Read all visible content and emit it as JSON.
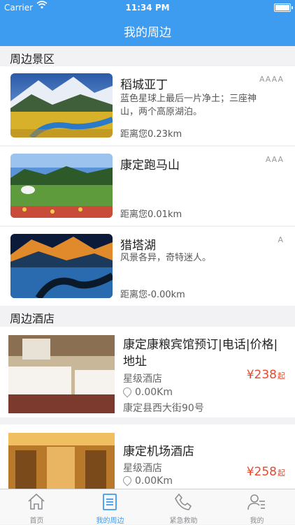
{
  "status": {
    "carrier": "Carrier",
    "time": "11:34 PM"
  },
  "header": {
    "title": "我的周边"
  },
  "sections": {
    "scenic": "周边景区",
    "hotels": "周边酒店"
  },
  "scenic": [
    {
      "name": "稻城亚丁",
      "desc": "蓝色星球上最后一片净土；三座神山，两个高原湖泊。",
      "grade": "AAAA",
      "distance": "距离您0.23km"
    },
    {
      "name": "康定跑马山",
      "desc": "",
      "grade": "AAA",
      "distance": "距离您0.01km"
    },
    {
      "name": "猎塔湖",
      "desc": "风景各异，奇特迷人。",
      "grade": "A",
      "distance": "距离您-0.00km"
    }
  ],
  "hotels": [
    {
      "name": "康定康粮宾馆预订|电话|价格|地址",
      "type": "星级酒店",
      "distance": "0.00Km",
      "address": "康定县西大街90号",
      "price": "¥238",
      "price_suffix": "起"
    },
    {
      "name": "康定机场酒店",
      "type": "星级酒店",
      "distance": "0.00Km",
      "price": "¥258",
      "price_suffix": "起"
    }
  ],
  "tabs": [
    {
      "label": "首页",
      "icon": "home-icon"
    },
    {
      "label": "我的周边",
      "icon": "list-icon"
    },
    {
      "label": "紧急救助",
      "icon": "phone-icon"
    },
    {
      "label": "我的",
      "icon": "user-icon"
    }
  ],
  "colors": {
    "accent": "#3d9bf0",
    "price": "#e8492c"
  }
}
